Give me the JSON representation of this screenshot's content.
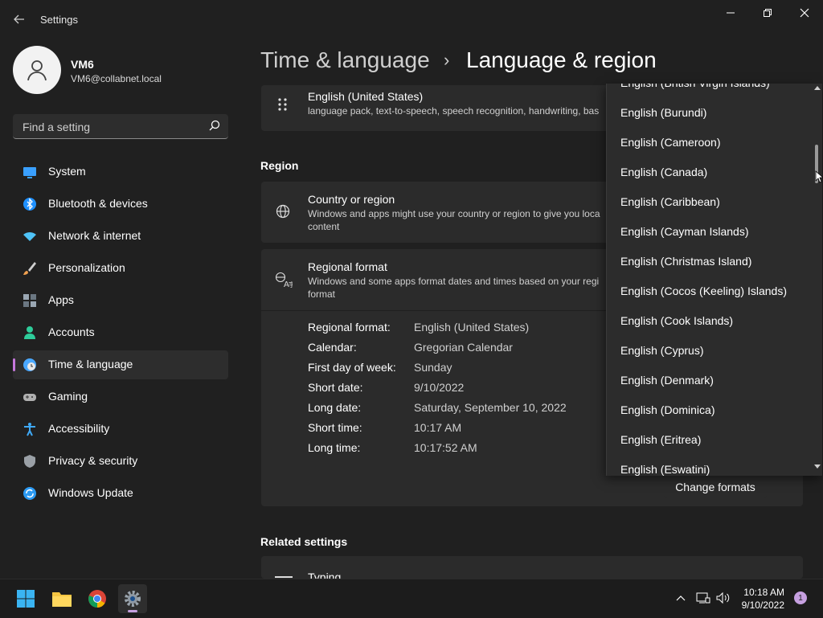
{
  "window": {
    "title": "Settings"
  },
  "user": {
    "name": "VM6",
    "email": "VM6@collabnet.local"
  },
  "search": {
    "placeholder": "Find a setting"
  },
  "nav": [
    {
      "label": "System",
      "icon": "monitor-icon",
      "color": "#3aa0ff"
    },
    {
      "label": "Bluetooth & devices",
      "icon": "bluetooth-icon",
      "color": "#1e90ff"
    },
    {
      "label": "Network & internet",
      "icon": "wifi-icon",
      "color": "#4fc3f7"
    },
    {
      "label": "Personalization",
      "icon": "brush-icon",
      "color": "#f0a050"
    },
    {
      "label": "Apps",
      "icon": "apps-icon",
      "color": "#9aa7b3"
    },
    {
      "label": "Accounts",
      "icon": "person-icon",
      "color": "#2ecc9a"
    },
    {
      "label": "Time & language",
      "icon": "clock-globe-icon",
      "color": "#4aa8ff",
      "active": true
    },
    {
      "label": "Gaming",
      "icon": "gamepad-icon",
      "color": "#b0b0b0"
    },
    {
      "label": "Accessibility",
      "icon": "accessibility-icon",
      "color": "#3fa9f5"
    },
    {
      "label": "Privacy & security",
      "icon": "shield-icon",
      "color": "#9aa0a6"
    },
    {
      "label": "Windows Update",
      "icon": "update-icon",
      "color": "#2b9af3"
    }
  ],
  "header": {
    "parent": "Time & language",
    "separator": "›",
    "current": "Language & region"
  },
  "language": {
    "name": "English (United States)",
    "desc": "language pack, text-to-speech, speech recognition, handwriting, bas"
  },
  "region": {
    "section_title": "Region",
    "country_title": "Country or region",
    "country_desc": "Windows and apps might use your country or region to give you loca content",
    "format_title": "Regional format",
    "format_desc": "Windows and some apps format dates and times based on your regi format"
  },
  "formats": [
    {
      "label": "Regional format:",
      "value": "English (United States)"
    },
    {
      "label": "Calendar:",
      "value": "Gregorian Calendar"
    },
    {
      "label": "First day of week:",
      "value": "Sunday"
    },
    {
      "label": "Short date:",
      "value": "9/10/2022"
    },
    {
      "label": "Long date:",
      "value": "Saturday, September 10, 2022"
    },
    {
      "label": "Short time:",
      "value": "10:17 AM"
    },
    {
      "label": "Long time:",
      "value": "10:17:52 AM"
    }
  ],
  "change_formats_label": "Change formats",
  "related": {
    "section_title": "Related settings",
    "typing": "Typing"
  },
  "dropdown": {
    "items": [
      "English (British Virgin Islands)",
      "English (Burundi)",
      "English (Cameroon)",
      "English (Canada)",
      "English (Caribbean)",
      "English (Cayman Islands)",
      "English (Christmas Island)",
      "English (Cocos (Keeling) Islands)",
      "English (Cook Islands)",
      "English (Cyprus)",
      "English (Denmark)",
      "English (Dominica)",
      "English (Eritrea)",
      "English (Eswatini)"
    ]
  },
  "taskbar": {
    "time": "10:18 AM",
    "date": "9/10/2022",
    "notifications": "1"
  },
  "colors": {
    "accent": "#c678dd",
    "background": "#202020",
    "card": "#2b2b2b"
  }
}
